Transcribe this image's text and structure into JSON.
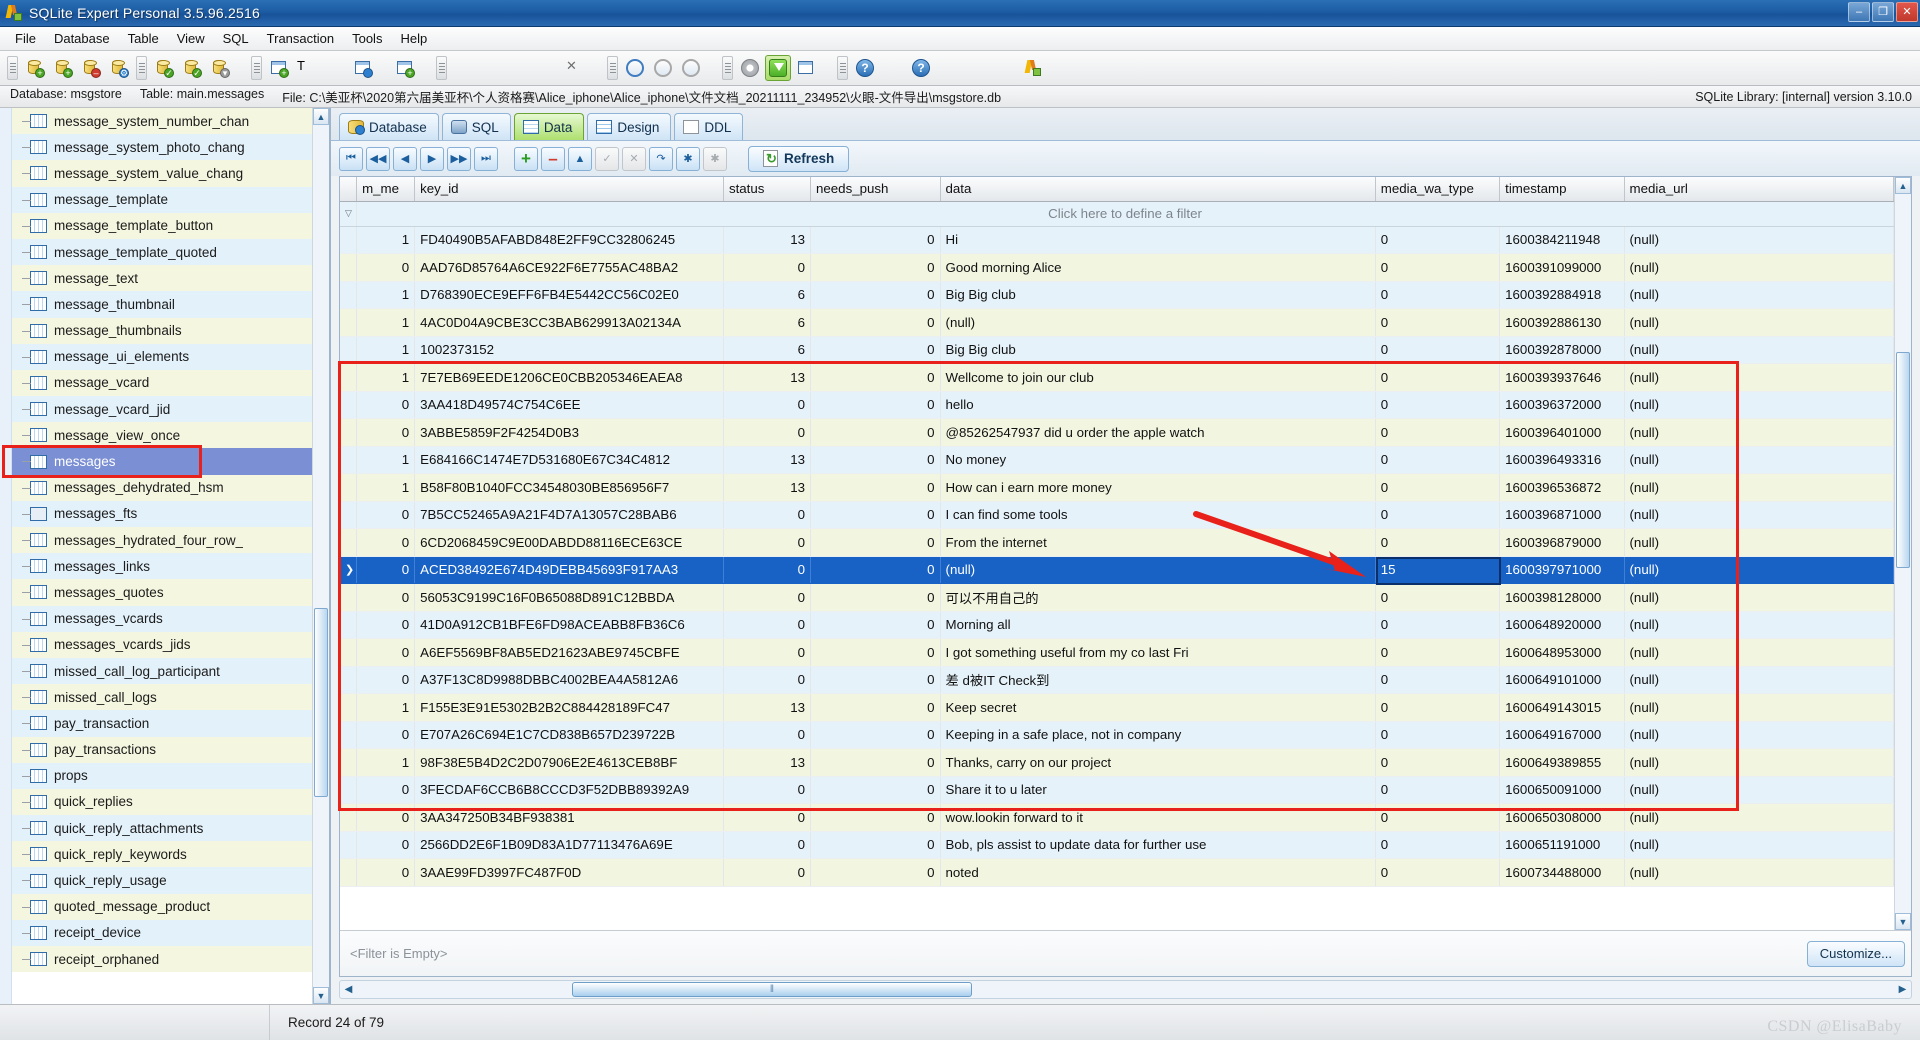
{
  "window": {
    "title": "SQLite Expert Personal 3.5.96.2516",
    "app_icon": "sqlite-expert-logo-icon",
    "buttons": {
      "minimize": "–",
      "maximize": "❐",
      "close": "✕"
    }
  },
  "menubar": [
    {
      "label": "File"
    },
    {
      "label": "Database"
    },
    {
      "label": "Table"
    },
    {
      "label": "View"
    },
    {
      "label": "SQL"
    },
    {
      "label": "Transaction"
    },
    {
      "label": "Tools"
    },
    {
      "label": "Help"
    }
  ],
  "toolbar": {
    "groups": [
      {
        "buttons": [
          {
            "name": "new-database-icon"
          },
          {
            "name": "add-database-icon"
          },
          {
            "name": "remove-database-icon"
          },
          {
            "name": "database-properties-icon"
          }
        ]
      },
      {
        "buttons": [
          {
            "name": "attach-database-icon"
          },
          {
            "name": "verify-database-icon"
          },
          {
            "name": "compact-database-icon"
          }
        ]
      },
      {
        "buttons": [
          {
            "name": "new-table-icon"
          },
          {
            "name": "rename-table-icon"
          },
          {
            "name": "refresh-table-icon"
          },
          {
            "name": "duplicate-table-icon"
          }
        ]
      },
      {
        "buttons": [
          {
            "name": "import-data-icon"
          }
        ]
      },
      {
        "buttons": [
          {
            "name": "sql-builder-icon"
          },
          {
            "name": "sql-query-icon"
          },
          {
            "name": "sql-save-icon"
          },
          {
            "name": "sql-open-icon"
          },
          {
            "name": "sql-cancel-icon"
          }
        ]
      },
      {
        "buttons": [
          {
            "name": "execute-icon"
          },
          {
            "name": "commit-icon"
          },
          {
            "name": "rollback-icon"
          }
        ]
      },
      {
        "buttons": [
          {
            "name": "options-gear-icon"
          },
          {
            "name": "filter-funnel-icon"
          },
          {
            "name": "grid-layout-icon"
          }
        ]
      },
      {
        "buttons": [
          {
            "name": "help-icon"
          },
          {
            "name": "home-icon"
          },
          {
            "name": "support-icon"
          },
          {
            "name": "feather-icon"
          },
          {
            "name": "mail-icon"
          },
          {
            "name": "about-doc-icon"
          },
          {
            "name": "sqlite-expert-icon"
          }
        ]
      }
    ]
  },
  "pathbar": {
    "database_label": "Database: msgstore",
    "table_label": "Table: main.messages",
    "file_label": "File: C:\\美亚杯\\2020第六届美亚杯\\个人资格赛\\Alice_iphone\\Alice_iphone\\文件文档_20211111_234952\\火眼-文件导出\\msgstore.db",
    "library_label": "SQLite Library: [internal] version 3.10.0"
  },
  "sidebar": {
    "items": [
      {
        "label": "message_system_number_chan",
        "icon": "table-icon"
      },
      {
        "label": "message_system_photo_chang",
        "icon": "table-icon"
      },
      {
        "label": "message_system_value_chang",
        "icon": "table-icon"
      },
      {
        "label": "message_template",
        "icon": "table-icon"
      },
      {
        "label": "message_template_button",
        "icon": "table-icon"
      },
      {
        "label": "message_template_quoted",
        "icon": "table-icon"
      },
      {
        "label": "message_text",
        "icon": "table-icon"
      },
      {
        "label": "message_thumbnail",
        "icon": "table-icon"
      },
      {
        "label": "message_thumbnails",
        "icon": "table-icon"
      },
      {
        "label": "message_ui_elements",
        "icon": "table-icon"
      },
      {
        "label": "message_vcard",
        "icon": "table-icon"
      },
      {
        "label": "message_vcard_jid",
        "icon": "table-icon"
      },
      {
        "label": "message_view_once",
        "icon": "table-icon"
      },
      {
        "label": "messages",
        "icon": "table-icon",
        "selected": true
      },
      {
        "label": "messages_dehydrated_hsm",
        "icon": "table-icon"
      },
      {
        "label": "messages_fts",
        "icon": "fts-table-icon"
      },
      {
        "label": "messages_hydrated_four_row_",
        "icon": "table-icon"
      },
      {
        "label": "messages_links",
        "icon": "table-icon"
      },
      {
        "label": "messages_quotes",
        "icon": "table-icon"
      },
      {
        "label": "messages_vcards",
        "icon": "table-icon"
      },
      {
        "label": "messages_vcards_jids",
        "icon": "table-icon"
      },
      {
        "label": "missed_call_log_participant",
        "icon": "table-icon"
      },
      {
        "label": "missed_call_logs",
        "icon": "table-icon"
      },
      {
        "label": "pay_transaction",
        "icon": "table-icon"
      },
      {
        "label": "pay_transactions",
        "icon": "table-icon"
      },
      {
        "label": "props",
        "icon": "table-icon"
      },
      {
        "label": "quick_replies",
        "icon": "table-icon"
      },
      {
        "label": "quick_reply_attachments",
        "icon": "table-icon"
      },
      {
        "label": "quick_reply_keywords",
        "icon": "table-icon"
      },
      {
        "label": "quick_reply_usage",
        "icon": "table-icon"
      },
      {
        "label": "quoted_message_product",
        "icon": "table-icon"
      },
      {
        "label": "receipt_device",
        "icon": "table-icon"
      },
      {
        "label": "receipt_orphaned",
        "icon": "table-icon"
      }
    ]
  },
  "tabs": [
    {
      "label": "Database",
      "icon": "database-icon",
      "selected": false
    },
    {
      "label": "SQL",
      "icon": "sql-icon",
      "selected": false
    },
    {
      "label": "Data",
      "icon": "data-grid-icon",
      "selected": true
    },
    {
      "label": "Design",
      "icon": "design-icon",
      "selected": false
    },
    {
      "label": "DDL",
      "icon": "ddl-icon",
      "selected": false
    }
  ],
  "navbar": {
    "buttons": [
      {
        "name": "first-record-button",
        "glyph": "⏮",
        "disabled": false
      },
      {
        "name": "prior-page-button",
        "glyph": "◀◀",
        "disabled": false
      },
      {
        "name": "prior-record-button",
        "glyph": "◀",
        "disabled": false
      },
      {
        "name": "next-record-button",
        "glyph": "▶",
        "disabled": false
      },
      {
        "name": "next-page-button",
        "glyph": "▶▶",
        "disabled": false
      },
      {
        "name": "last-record-button",
        "glyph": "⏭",
        "disabled": false
      },
      {
        "name": "insert-record-button",
        "glyph": "+",
        "disabled": false
      },
      {
        "name": "delete-record-button",
        "glyph": "–",
        "disabled": false
      },
      {
        "name": "edit-record-button",
        "glyph": "▲",
        "disabled": false
      },
      {
        "name": "post-edit-button",
        "glyph": "✓",
        "disabled": true
      },
      {
        "name": "cancel-edit-button",
        "glyph": "✕",
        "disabled": true
      },
      {
        "name": "refresh-record-button",
        "glyph": "↷",
        "disabled": false
      },
      {
        "name": "set-null-button",
        "glyph": "✱",
        "disabled": false
      },
      {
        "name": "clear-null-button",
        "glyph": "✱",
        "disabled": true
      }
    ],
    "refresh_label": "Refresh",
    "refresh_icon": "refresh-icon"
  },
  "grid": {
    "filter_hint": "Click here to define a filter",
    "columns": [
      {
        "key": "from_me",
        "label": "m_me",
        "align": "right"
      },
      {
        "key": "key_id",
        "label": "key_id",
        "align": "left"
      },
      {
        "key": "status",
        "label": "status",
        "align": "right"
      },
      {
        "key": "needs_push",
        "label": "needs_push",
        "align": "right"
      },
      {
        "key": "data",
        "label": "data",
        "align": "left"
      },
      {
        "key": "media_wa_type",
        "label": "media_wa_type",
        "align": "left"
      },
      {
        "key": "timestamp",
        "label": "timestamp",
        "align": "left"
      },
      {
        "key": "media_url",
        "label": "media_url",
        "align": "left"
      }
    ],
    "rows": [
      {
        "from_me": "1",
        "key_id": "FD40490B5AFABD848E2FF9CC32806245",
        "status": "13",
        "needs_push": "0",
        "data": "Hi",
        "media_wa_type": "0",
        "timestamp": "1600384211948",
        "media_url": "(null)"
      },
      {
        "from_me": "0",
        "key_id": "AAD76D85764A6CE922F6E7755AC48BA2",
        "status": "0",
        "needs_push": "0",
        "data": "Good morning Alice",
        "media_wa_type": "0",
        "timestamp": "1600391099000",
        "media_url": "(null)"
      },
      {
        "from_me": "1",
        "key_id": "D768390ECE9EFF6FB4E5442CC56C02E0",
        "status": "6",
        "needs_push": "0",
        "data": "Big Big club",
        "media_wa_type": "0",
        "timestamp": "1600392884918",
        "media_url": "(null)"
      },
      {
        "from_me": "1",
        "key_id": "4AC0D04A9CBE3CC3BAB629913A02134A",
        "status": "6",
        "needs_push": "0",
        "data": "(null)",
        "media_wa_type": "0",
        "timestamp": "1600392886130",
        "media_url": "(null)"
      },
      {
        "from_me": "1",
        "key_id": "1002373152",
        "status": "6",
        "needs_push": "0",
        "data": "Big Big club",
        "media_wa_type": "0",
        "timestamp": "1600392878000",
        "media_url": "(null)"
      },
      {
        "from_me": "1",
        "key_id": "7E7EB69EEDE1206CE0CBB205346EAEA8",
        "status": "13",
        "needs_push": "0",
        "data": "Wellcome to join our club",
        "media_wa_type": "0",
        "timestamp": "1600393937646",
        "media_url": "(null)"
      },
      {
        "from_me": "0",
        "key_id": "3AA418D49574C754C6EE",
        "status": "0",
        "needs_push": "0",
        "data": "hello",
        "media_wa_type": "0",
        "timestamp": "1600396372000",
        "media_url": "(null)"
      },
      {
        "from_me": "0",
        "key_id": "3ABBE5859F2F4254D0B3",
        "status": "0",
        "needs_push": "0",
        "data": "@85262547937 did u order the apple watch",
        "media_wa_type": "0",
        "timestamp": "1600396401000",
        "media_url": "(null)"
      },
      {
        "from_me": "1",
        "key_id": "E684166C1474E7D531680E67C34C4812",
        "status": "13",
        "needs_push": "0",
        "data": "No money",
        "media_wa_type": "0",
        "timestamp": "1600396493316",
        "media_url": "(null)"
      },
      {
        "from_me": "1",
        "key_id": "B58F80B1040FCC34548030BE856956F7",
        "status": "13",
        "needs_push": "0",
        "data": "How can i earn more money",
        "media_wa_type": "0",
        "timestamp": "1600396536872",
        "media_url": "(null)"
      },
      {
        "from_me": "0",
        "key_id": "7B5CC52465A9A21F4D7A13057C28BAB6",
        "status": "0",
        "needs_push": "0",
        "data": "I can find some tools",
        "media_wa_type": "0",
        "timestamp": "1600396871000",
        "media_url": "(null)"
      },
      {
        "from_me": "0",
        "key_id": "6CD2068459C9E00DABDD88116ECE63CE",
        "status": "0",
        "needs_push": "0",
        "data": "From the internet",
        "media_wa_type": "0",
        "timestamp": "1600396879000",
        "media_url": "(null)"
      },
      {
        "from_me": "0",
        "key_id": "ACED38492E674D49DEBB45693F917AA3",
        "status": "0",
        "needs_push": "0",
        "data": "(null)",
        "media_wa_type": "15",
        "timestamp": "1600397971000",
        "media_url": "(null)",
        "selected": true
      },
      {
        "from_me": "0",
        "key_id": "56053C9199C16F0B65088D891C12BBDA",
        "status": "0",
        "needs_push": "0",
        "data": "可以不用自己的",
        "media_wa_type": "0",
        "timestamp": "1600398128000",
        "media_url": "(null)"
      },
      {
        "from_me": "0",
        "key_id": "41D0A912CB1BFE6FD98ACEABB8FB36C6",
        "status": "0",
        "needs_push": "0",
        "data": "Morning all",
        "media_wa_type": "0",
        "timestamp": "1600648920000",
        "media_url": "(null)"
      },
      {
        "from_me": "0",
        "key_id": "A6EF5569BF8AB5ED21623ABE9745CBFE",
        "status": "0",
        "needs_push": "0",
        "data": "I got something useful from my co last Fri",
        "media_wa_type": "0",
        "timestamp": "1600648953000",
        "media_url": "(null)"
      },
      {
        "from_me": "0",
        "key_id": "A37F13C8D9988DBBC4002BEA4A5812A6",
        "status": "0",
        "needs_push": "0",
        "data": "差 d被IT Check到",
        "media_wa_type": "0",
        "timestamp": "1600649101000",
        "media_url": "(null)"
      },
      {
        "from_me": "1",
        "key_id": "F155E3E91E5302B2B2C884428189FC47",
        "status": "13",
        "needs_push": "0",
        "data": "Keep secret",
        "media_wa_type": "0",
        "timestamp": "1600649143015",
        "media_url": "(null)"
      },
      {
        "from_me": "0",
        "key_id": "E707A26C694E1C7CD838B657D239722B",
        "status": "0",
        "needs_push": "0",
        "data": "Keeping in a safe place, not in company",
        "media_wa_type": "0",
        "timestamp": "1600649167000",
        "media_url": "(null)"
      },
      {
        "from_me": "1",
        "key_id": "98F38E5B4D2C2D07906E2E4613CEB8BF",
        "status": "13",
        "needs_push": "0",
        "data": "Thanks, carry on our project",
        "media_wa_type": "0",
        "timestamp": "1600649389855",
        "media_url": "(null)"
      },
      {
        "from_me": "0",
        "key_id": "3FECDAF6CCB6B8CCCD3F52DBB89392A9",
        "status": "0",
        "needs_push": "0",
        "data": "Share it to u later",
        "media_wa_type": "0",
        "timestamp": "1600650091000",
        "media_url": "(null)"
      },
      {
        "from_me": "0",
        "key_id": "3AA347250B34BF938381",
        "status": "0",
        "needs_push": "0",
        "data": "wow.lookin forward to it",
        "media_wa_type": "0",
        "timestamp": "1600650308000",
        "media_url": "(null)"
      },
      {
        "from_me": "0",
        "key_id": "2566DD2E6F1B09D83A1D77113476A69E",
        "status": "0",
        "needs_push": "0",
        "data": "Bob, pls assist to update data for further use",
        "media_wa_type": "0",
        "timestamp": "1600651191000",
        "media_url": "(null)"
      },
      {
        "from_me": "0",
        "key_id": "3AAE99FD3997FC487F0D",
        "status": "0",
        "needs_push": "0",
        "data": "noted",
        "media_wa_type": "0",
        "timestamp": "1600734488000",
        "media_url": "(null)"
      }
    ],
    "footer": {
      "filter_state": "<Filter is Empty>",
      "customize_label": "Customize..."
    }
  },
  "statusbar": {
    "record_label": "Record 24 of 79",
    "watermark": "CSDN @ElisaBaby"
  },
  "annotations": {
    "accent_red": "#e8211a",
    "selection_blue": "#1862c6",
    "tree_selection": "#7b8fd4"
  }
}
